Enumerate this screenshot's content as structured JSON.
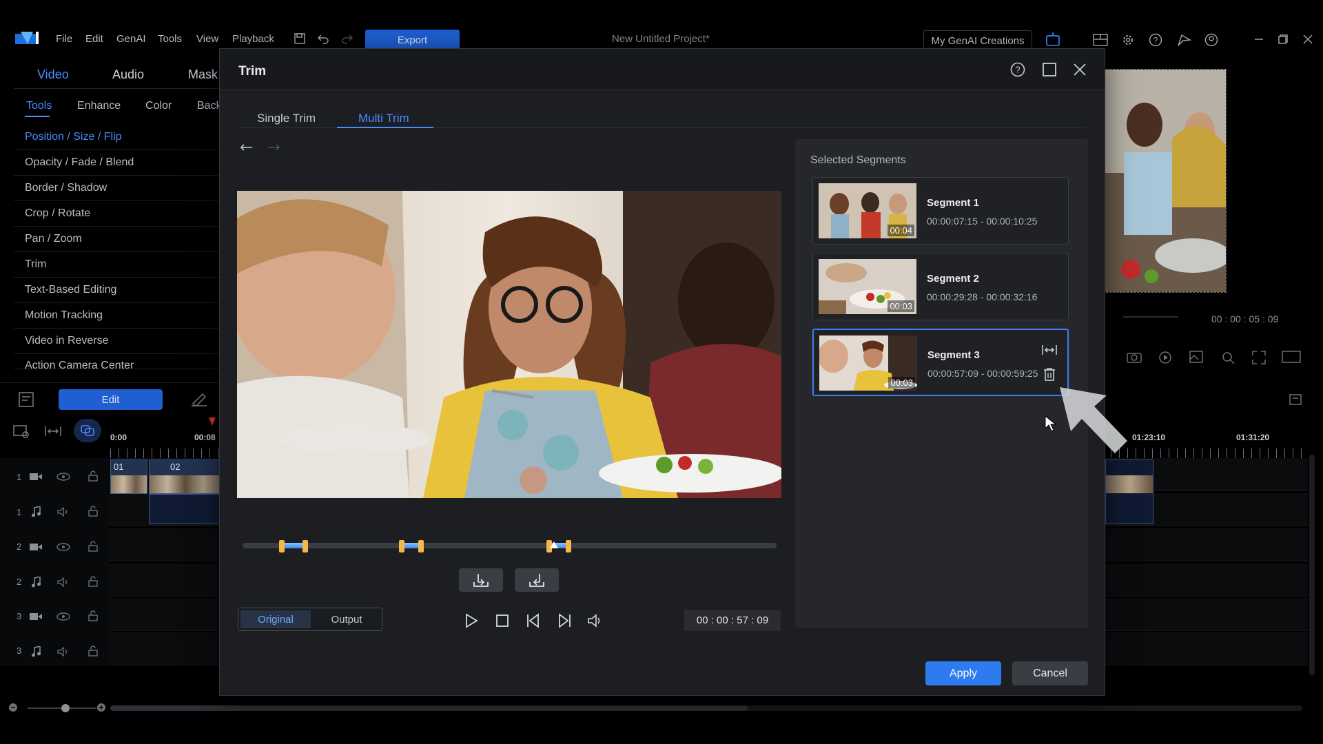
{
  "menubar": {
    "items": [
      "File",
      "Edit",
      "GenAI",
      "Tools",
      "View",
      "Playback"
    ],
    "export_label": "Export",
    "project_title": "New Untitled Project*",
    "genai_creations_label": "My GenAI Creations"
  },
  "left_panel": {
    "main_tabs": [
      "Video",
      "Audio",
      "Mask"
    ],
    "sub_tabs": [
      "Tools",
      "Enhance",
      "Color",
      "Back"
    ],
    "tools": [
      "Position / Size / Flip",
      "Opacity / Fade / Blend",
      "Border / Shadow",
      "Crop / Rotate",
      "Pan / Zoom",
      "Trim",
      "Text-Based Editing",
      "Motion Tracking",
      "Video in Reverse",
      "Action Camera Center"
    ]
  },
  "timeline": {
    "edit_label": "Edit",
    "ruler": [
      "0:00",
      "00:08",
      "01:23:10",
      "01:31:20"
    ],
    "tracks": [
      "1",
      "1",
      "2",
      "2",
      "3",
      "3"
    ],
    "clips": [
      "01",
      "02"
    ]
  },
  "preview": {
    "timecode": "00 : 00 : 05 : 09"
  },
  "trim_dialog": {
    "title": "Trim",
    "tabs": [
      "Single Trim",
      "Multi Trim"
    ],
    "active_tab": "Multi Trim",
    "view_toggle": {
      "original": "Original",
      "output": "Output"
    },
    "timecode": "00 : 00 : 57 : 09",
    "segments_title": "Selected Segments",
    "segments": [
      {
        "name": "Segment 1",
        "range": "00:00:07:15 - 00:00:10:25",
        "duration": "00:04"
      },
      {
        "name": "Segment 2",
        "range": "00:00:29:28 - 00:00:32:16",
        "duration": "00:03"
      },
      {
        "name": "Segment 3",
        "range": "00:00:57:09 - 00:00:59:25",
        "duration": "00:03"
      }
    ],
    "apply_label": "Apply",
    "cancel_label": "Cancel"
  },
  "colors": {
    "accent": "#2e7bf0",
    "handle": "#f5b845",
    "dialog_bg": "#1c1e22"
  }
}
